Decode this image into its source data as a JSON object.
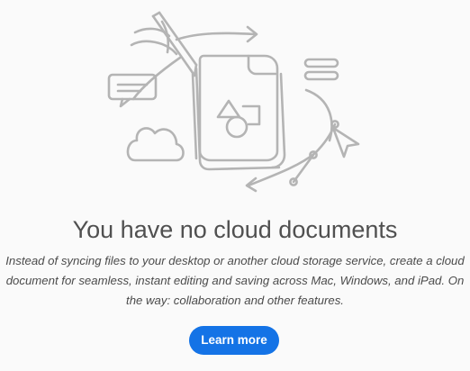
{
  "empty_state": {
    "title": "You have no cloud documents",
    "description": "Instead of syncing files to your desktop or another cloud storage service, create a cloud document for seamless, instant editing and saving across Mac, Windows, and iPad. On the way: collaboration and other features.",
    "learn_more_label": "Learn more",
    "illustration_icons": [
      "pen-icon",
      "arrow-icon",
      "chat-bubble-icon",
      "cloud-icon",
      "document-stack-icon",
      "shapes-icon",
      "menu-lines-icon",
      "pointer-icon",
      "curve-path-icon"
    ]
  },
  "colors": {
    "background": "#fafafa",
    "line_art": "#b4b4b4",
    "title": "#505050",
    "text": "#4b4b4b",
    "accent": "#1473e6"
  }
}
